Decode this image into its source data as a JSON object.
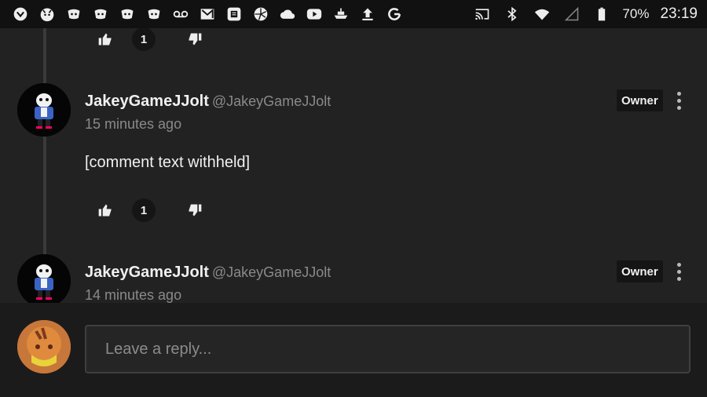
{
  "status_bar": {
    "left_icons": [
      "shield-icon",
      "cat-icon",
      "discord-icon",
      "discord-icon",
      "discord-icon",
      "discord-icon",
      "voicemail-icon",
      "gmail-icon",
      "calendar-icon",
      "aperture-icon",
      "cloud-icon",
      "youtube-icon",
      "ship-icon",
      "upload-icon",
      "google-icon"
    ],
    "battery": "70%",
    "time": "23:19"
  },
  "comments": [
    {
      "author": "JakeyGameJJolt",
      "handle": "@JakeyGameJJolt",
      "time": "15 minutes ago",
      "text": "[comment text withheld]",
      "badge": "Owner",
      "votes": "1"
    },
    {
      "author": "JakeyGameJJolt",
      "handle": "@JakeyGameJJolt",
      "time": "14 minutes ago",
      "badge": "Owner"
    }
  ],
  "top_votes": "1",
  "reply": {
    "placeholder": "Leave a reply..."
  },
  "colors": {
    "background": "#232323",
    "status_bar": "#111111",
    "reply_bar": "#1b1b1b",
    "muted_text": "#8a8a8a"
  }
}
